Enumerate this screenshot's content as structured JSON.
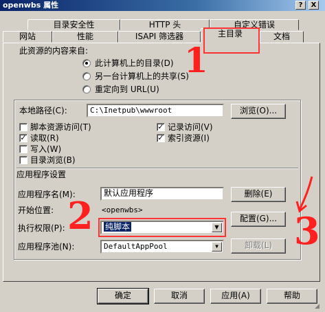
{
  "window": {
    "title": "openwbs 属性",
    "help_btn": "?",
    "close_btn": "X"
  },
  "tabs": {
    "row1": [
      "目录安全性",
      "HTTP 头",
      "自定义错误"
    ],
    "row2": [
      "网站",
      "性能",
      "ISAPI 筛选器",
      "主目录",
      "文档"
    ],
    "active": "主目录"
  },
  "content_source": {
    "heading": "此资源的内容来自:",
    "options": [
      "此计算机上的目录(D)",
      "另一台计算机上的共享(S)",
      "重定向到 URL(U)"
    ],
    "selected_index": 0
  },
  "local_path": {
    "label": "本地路径(C):",
    "value": "C:\\Inetpub\\wwwroot",
    "browse_btn": "浏览(O)..."
  },
  "permissions": [
    {
      "label": "脚本资源访问(T)",
      "checked": false
    },
    {
      "label": "记录访问(V)",
      "checked": true
    },
    {
      "label": "读取(R)",
      "checked": true
    },
    {
      "label": "索引资源(I)",
      "checked": true
    },
    {
      "label": "写入(W)",
      "checked": false
    },
    {
      "label": "目录浏览(B)",
      "checked": false
    }
  ],
  "app_settings": {
    "heading": "应用程序设置",
    "app_name_label": "应用程序名(M):",
    "app_name_value": "默认应用程序",
    "remove_btn": "删除(E)",
    "start_point_label": "开始位置:",
    "start_point_value": "<openwbs>",
    "config_btn": "配置(G)...",
    "exec_perm_label": "执行权限(P):",
    "exec_perm_value": "纯脚本",
    "app_pool_label": "应用程序池(N):",
    "app_pool_value": "DefaultAppPool",
    "unload_btn": "卸载(L)"
  },
  "footer": {
    "ok": "确定",
    "cancel": "取消",
    "apply": "应用(A)",
    "help": "帮助"
  },
  "annotations": {
    "one": "1",
    "two": "2",
    "three": "3",
    "color": "#ff2020"
  }
}
